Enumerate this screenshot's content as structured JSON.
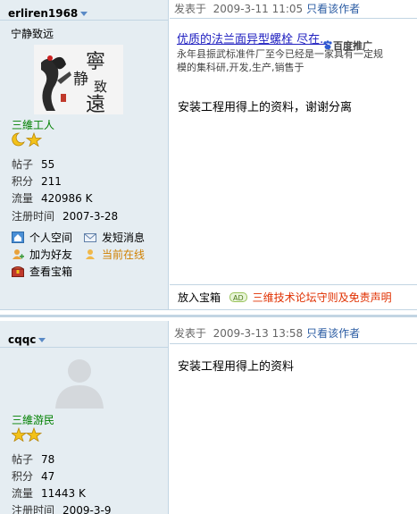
{
  "posts": [
    {
      "username": "erliren1968",
      "signature": "宁静致远",
      "avatar_text": "寧静致遠",
      "group": "三維工人",
      "stats": [
        {
          "label": "帖子",
          "value": "55"
        },
        {
          "label": "积分",
          "value": "211"
        },
        {
          "label": "流量",
          "value": "420986 K"
        },
        {
          "label": "注册时间",
          "value": "2007-3-28"
        }
      ],
      "actions": {
        "home": "个人空间",
        "message": "发短消息",
        "friend": "加为好友",
        "online": "当前在线",
        "treasure": "查看宝箱"
      },
      "posted_label": "发表于",
      "posted_time": "2009-3-11 11:05",
      "author_only": "只看该作者",
      "ad": {
        "title": "优质的法兰面异型螺栓 尽在..",
        "desc": "永年县振武标准件厂至今已经是一家具有一定规模的集科研,开发,生产,销售于",
        "brand": "百度推广"
      },
      "content": "安装工程用得上的资料，谢谢分离",
      "footer": {
        "put_box": "放入宝箱",
        "ad_badge": "AD",
        "rules": "三维技术论坛守则及免责声明"
      }
    },
    {
      "username": "cqqc",
      "group": "三維游民",
      "stats": [
        {
          "label": "帖子",
          "value": "78"
        },
        {
          "label": "积分",
          "value": "47"
        },
        {
          "label": "流量",
          "value": "11443 K"
        },
        {
          "label": "注册时间",
          "value": "2009-3-9"
        }
      ],
      "posted_label": "发表于",
      "posted_time": "2009-3-13 13:58",
      "author_only": "只看该作者",
      "content": "安装工程用得上的资料"
    }
  ],
  "colors": {
    "sidebar_bg": "#e5edf2",
    "border": "#c2d5e3",
    "link": "#2b5ca3",
    "group_green": "#008000",
    "online_orange": "#d08000",
    "rules_red": "#e03000"
  }
}
